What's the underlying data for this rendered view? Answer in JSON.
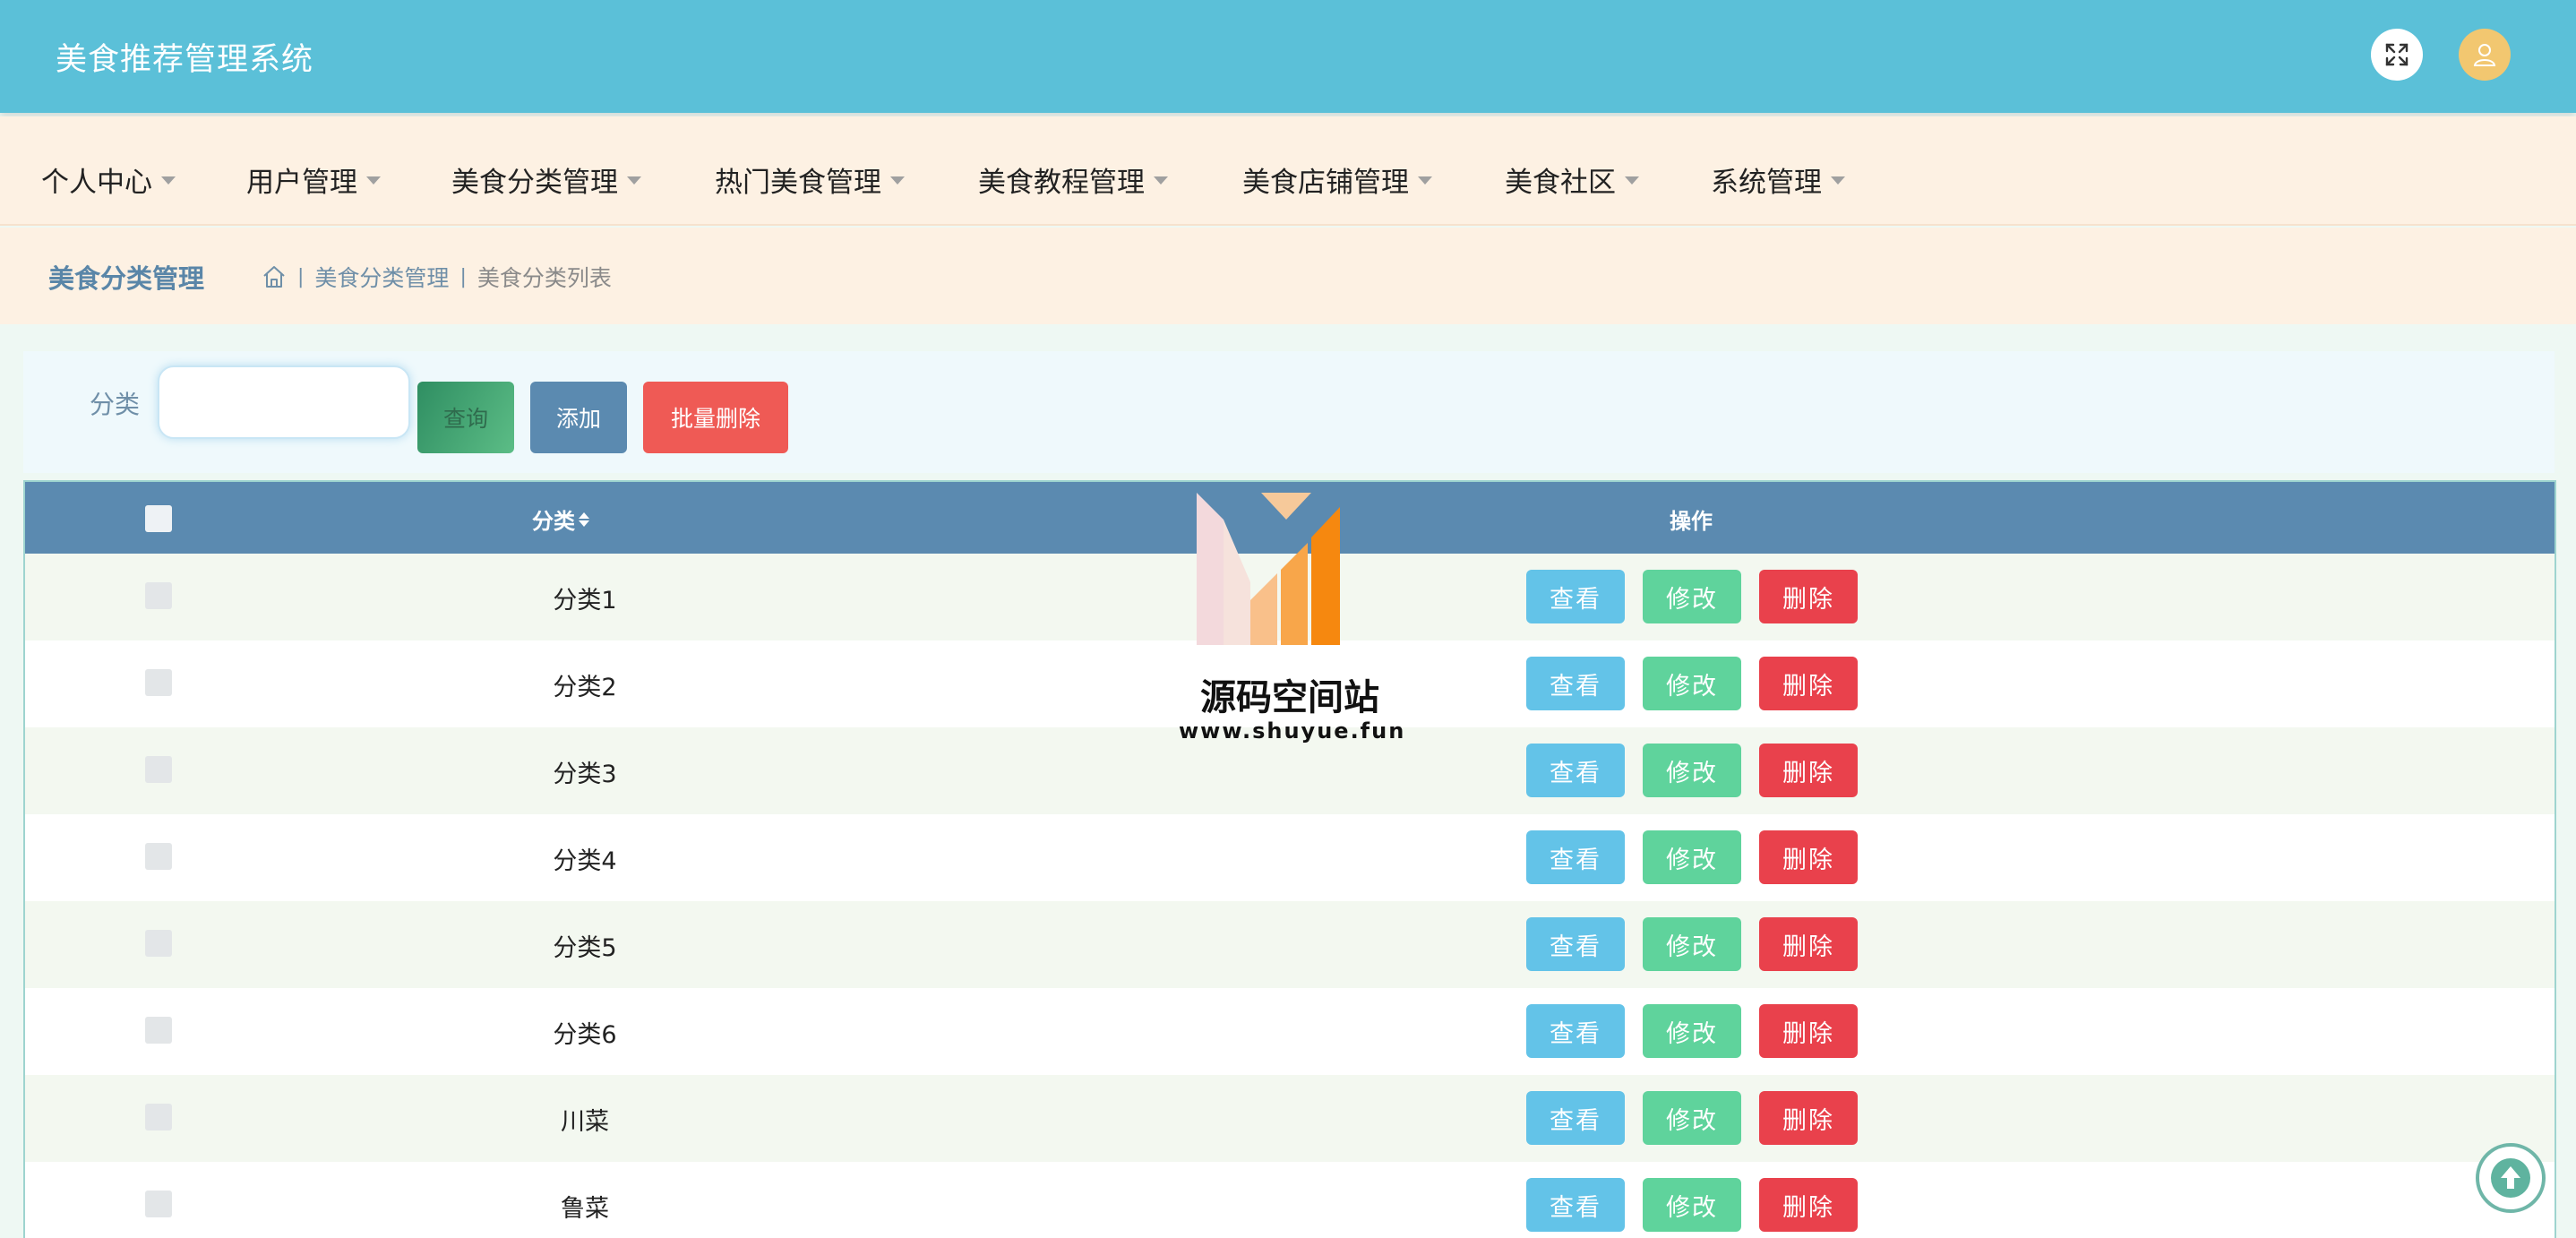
{
  "app": {
    "title": "美食推荐管理系统"
  },
  "header": {
    "fullscreen_icon": "fullscreen-icon",
    "avatar_icon": "user-icon",
    "colors": {
      "bar": "#5bc0d8",
      "avatar": "#f2c770"
    }
  },
  "nav": {
    "items": [
      {
        "label": "个人中心"
      },
      {
        "label": "用户管理"
      },
      {
        "label": "美食分类管理"
      },
      {
        "label": "热门美食管理"
      },
      {
        "label": "美食教程管理"
      },
      {
        "label": "美食店铺管理"
      },
      {
        "label": "美食社区"
      },
      {
        "label": "系统管理"
      }
    ]
  },
  "breadcrumb": {
    "title": "美食分类管理",
    "home_icon": "home-icon",
    "separator": "|",
    "level1": "美食分类管理",
    "level2": "美食分类列表"
  },
  "search": {
    "label": "分类",
    "value": "",
    "placeholder": "",
    "query_label": "查询",
    "add_label": "添加",
    "batch_delete_label": "批量删除"
  },
  "table": {
    "columns": {
      "category": "分类",
      "actions": "操作"
    },
    "actions": {
      "view": "查看",
      "edit": "修改",
      "delete": "删除"
    },
    "rows": [
      {
        "category": "分类1"
      },
      {
        "category": "分类2"
      },
      {
        "category": "分类3"
      },
      {
        "category": "分类4"
      },
      {
        "category": "分类5"
      },
      {
        "category": "分类6"
      },
      {
        "category": "川菜"
      },
      {
        "category": "鲁菜"
      }
    ]
  },
  "watermark": {
    "title": "源码空间站",
    "url": "www.shuyue.fun"
  },
  "backtop_icon": "arrow-up-icon"
}
